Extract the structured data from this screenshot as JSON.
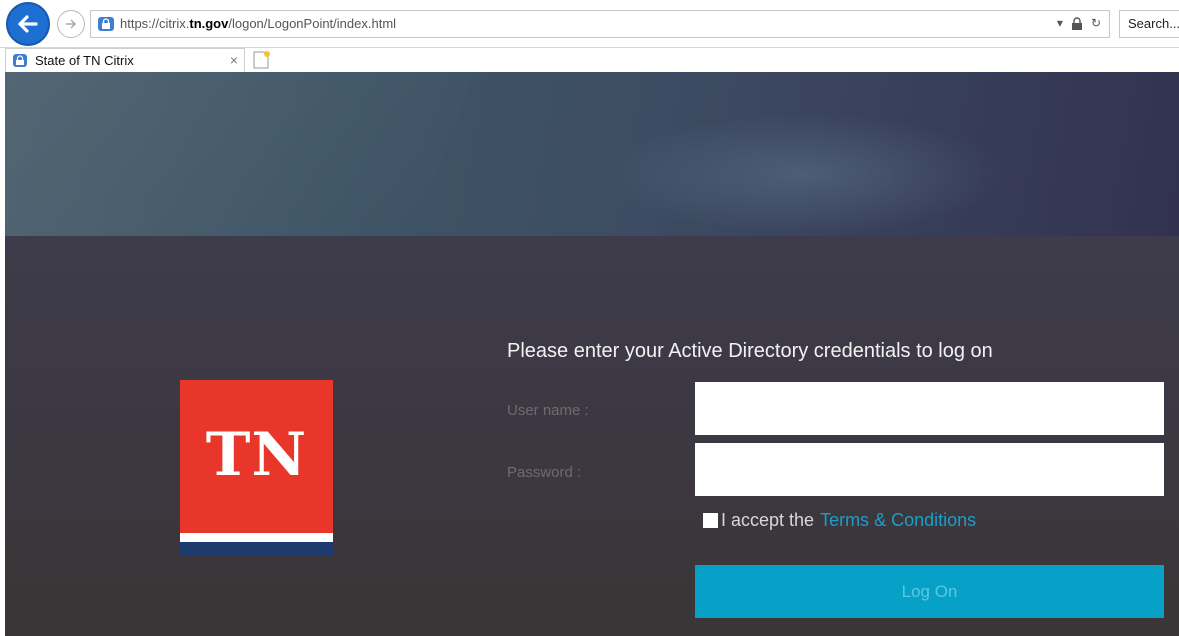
{
  "browser": {
    "url_proto": "https://citrix.",
    "url_host": "tn.gov",
    "url_path": "/logon/LogonPoint/index.html",
    "search_placeholder": "Search...",
    "tab_title": "State of TN Citrix",
    "tab_close": "×"
  },
  "logo": {
    "text": "TN",
    "colors": {
      "red": "#e8372a",
      "blue": "#1d3b6e"
    }
  },
  "login": {
    "heading": "Please enter your Active Directory credentials to log on",
    "username_label": "User name :",
    "username_value": "",
    "password_label": "Password :",
    "password_value": "",
    "accept_prefix": "I accept the",
    "terms_link": "Terms & Conditions",
    "accept_checked": false,
    "logon_button": "Log On",
    "accent_color": "#07a1c7"
  }
}
